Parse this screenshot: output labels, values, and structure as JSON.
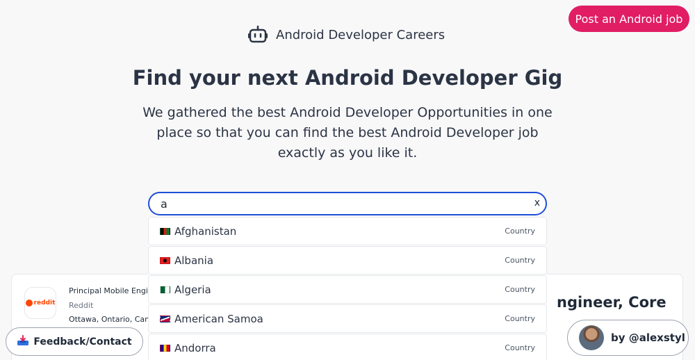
{
  "header": {
    "brand_name": "Android Developer Careers",
    "brand_icon": "robot-icon",
    "post_job_label": "Post an Android job",
    "post_job_color": "#e11d63"
  },
  "hero": {
    "headline": "Find your next Android Developer Gig",
    "subhead": "We gathered the best Android Developer Opportunities in one place so that you can find the best Android Developer job exactly as you like it."
  },
  "search": {
    "value": "a",
    "clear_label": "x",
    "border_color": "#1d4ed8"
  },
  "dropdown": {
    "items": [
      {
        "name": "Afghanistan",
        "type": "Country",
        "flag": "afghanistan-flag-icon"
      },
      {
        "name": "Albania",
        "type": "Country",
        "flag": "albania-flag-icon"
      },
      {
        "name": "Algeria",
        "type": "Country",
        "flag": "algeria-flag-icon"
      },
      {
        "name": "American Samoa",
        "type": "Country",
        "flag": "american-samoa-flag-icon"
      },
      {
        "name": "Andorra",
        "type": "Country",
        "flag": "andorra-flag-icon"
      }
    ]
  },
  "job": {
    "logo_text": "reddit",
    "title": "Principal Mobile Engin",
    "company": "Reddit",
    "location": "Ottawa, Ontario, Can",
    "heading_right": "ngineer, Core"
  },
  "footer": {
    "feedback_label": "Feedback/Contact",
    "feedback_icon": "inbox-tray-icon",
    "byline": "by @alexstyl"
  }
}
